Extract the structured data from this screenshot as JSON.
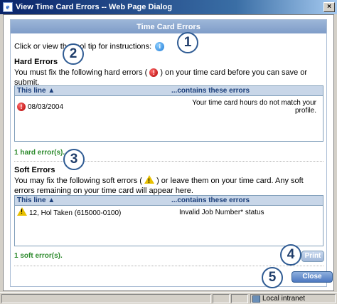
{
  "window": {
    "title": "View Time Card Errors -- Web Page Dialog",
    "close_glyph": "×"
  },
  "panel": {
    "header": "Time Card Errors"
  },
  "instructions": {
    "text": "Click or view the tool tip for instructions:"
  },
  "hard": {
    "title": "Hard Errors",
    "desc_before": "You must fix the following hard errors (",
    "desc_after": ") on your time card before you can save or submit.",
    "col_line": "This line ▲",
    "col_contains": "...contains these errors",
    "rows": [
      {
        "line": "08/03/2004",
        "error": "Your time card hours do not match your profile."
      }
    ],
    "count": "1 hard error(s)."
  },
  "soft": {
    "title": "Soft Errors",
    "desc_before": "You may fix the following soft errors (",
    "desc_after": ") or leave them on your time card. Any soft errors remaining on your time card will appear here.",
    "col_line": "This line ▲",
    "col_contains": "...contains these errors",
    "rows": [
      {
        "line": "12, Hol Taken (615000-0100)",
        "error": "Invalid Job Number* status"
      }
    ],
    "count": "1 soft error(s)."
  },
  "callouts": [
    "1",
    "2",
    "3",
    "4",
    "5"
  ],
  "buttons": {
    "print": "Print",
    "close": "Close"
  },
  "status": {
    "zone": "Local intranet"
  },
  "icons": {
    "info": "info-icon",
    "hard_error": "error-icon",
    "soft_error": "warning-icon"
  },
  "colors": {
    "header": "#7f9cc8",
    "count_green": "#2e8b2e",
    "callout_border": "#2f5b93"
  }
}
